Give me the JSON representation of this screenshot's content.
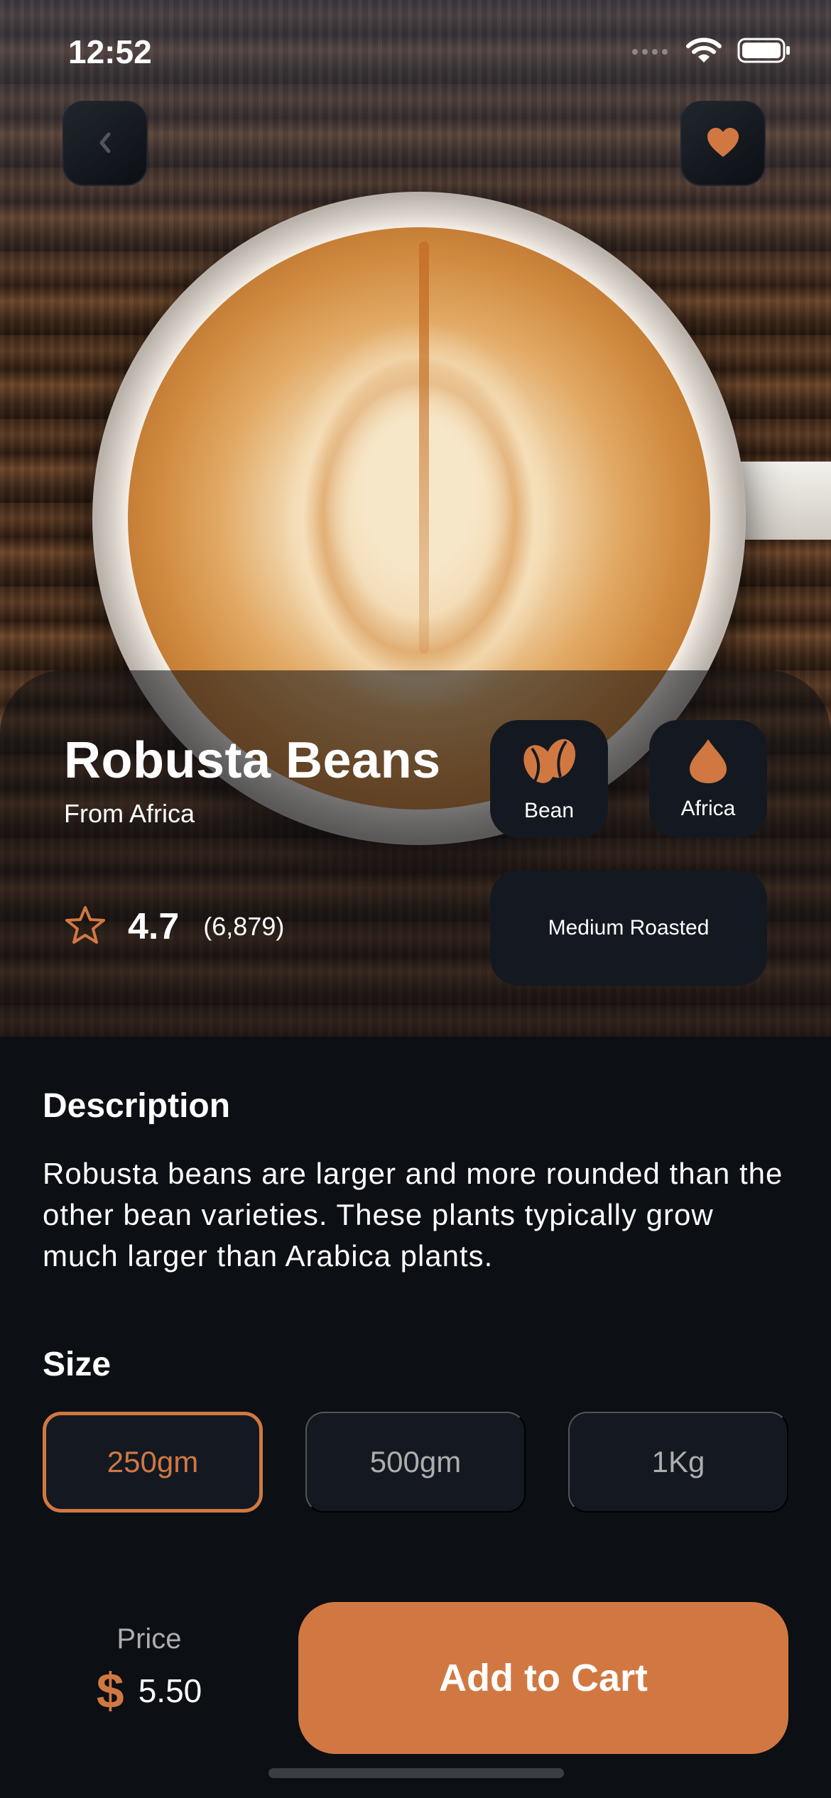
{
  "status_bar": {
    "time": "12:52",
    "icons": [
      "signal-icon",
      "wifi-icon",
      "battery-icon"
    ]
  },
  "header": {
    "back_icon": "chevron-left-icon",
    "favorite_icon": "heart-icon"
  },
  "product": {
    "name": "Robusta Beans",
    "origin_line": "From Africa",
    "rating": "4.7",
    "rating_count": "(6,879)",
    "tags": [
      {
        "label": "Bean",
        "icon": "coffee-bean-icon"
      },
      {
        "label": "Africa",
        "icon": "location-drop-icon"
      }
    ],
    "roast": "Medium Roasted"
  },
  "description": {
    "title": "Description",
    "text": "Robusta beans are larger and more rounded than the other bean varieties. These plants typically grow much larger than Arabica plants."
  },
  "size": {
    "title": "Size",
    "options": [
      "250gm",
      "500gm",
      "1Kg"
    ],
    "selected": "250gm"
  },
  "price": {
    "label": "Price",
    "currency": "$",
    "value": "5.50"
  },
  "cart": {
    "button_label": "Add to Cart"
  },
  "colors": {
    "accent": "#D17842",
    "background": "#0C0F14",
    "card": "#141921",
    "muted_text": "#AEAEAE"
  }
}
